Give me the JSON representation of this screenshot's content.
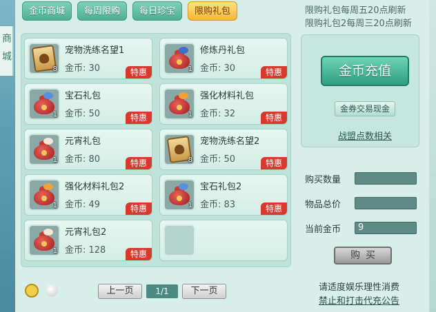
{
  "left_sidebar": {
    "label": "商城"
  },
  "tabs": [
    {
      "label": "金币商城",
      "active": false
    },
    {
      "label": "每周限购",
      "active": false
    },
    {
      "label": "每日珍宝",
      "active": false
    },
    {
      "label": "限购礼包",
      "active": true
    }
  ],
  "refresh_note": [
    "限购礼包每周五20点刷新",
    "限购礼包2每周三20点刷新"
  ],
  "items": [
    {
      "name": "宠物洗练名望1",
      "price": "金币: 30",
      "count": "8",
      "badge": "特惠",
      "icon": "scroll-icon"
    },
    {
      "name": "修炼丹礼包",
      "price": "金币: 30",
      "count": "1",
      "badge": "特惠",
      "icon": "gift-bag-icon"
    },
    {
      "name": "宝石礼包",
      "price": "金币: 50",
      "count": "1",
      "badge": "特惠",
      "icon": "gift-bag-icon"
    },
    {
      "name": "强化材料礼包",
      "price": "金币: 32",
      "count": "1",
      "badge": "特惠",
      "icon": "gift-bag-icon"
    },
    {
      "name": "元宵礼包",
      "price": "金币: 80",
      "count": "1",
      "badge": "特惠",
      "icon": "gift-bag-icon"
    },
    {
      "name": "宠物洗练名望2",
      "price": "金币: 50",
      "count": "8",
      "badge": "特惠",
      "icon": "scroll-icon"
    },
    {
      "name": "强化材料礼包2",
      "price": "金币: 49",
      "count": "1",
      "badge": "特惠",
      "icon": "gift-bag-icon"
    },
    {
      "name": "宝石礼包2",
      "price": "金币: 83",
      "count": "1",
      "badge": "特惠",
      "icon": "gift-bag-icon"
    },
    {
      "name": "元宵礼包2",
      "price": "金币: 128",
      "count": "1",
      "badge": "特惠",
      "icon": "gift-bag-icon"
    }
  ],
  "pager": {
    "prev_label": "上一页",
    "page": "1/1",
    "next_label": "下一页"
  },
  "right_panel": {
    "recharge_label": "金币充值",
    "exchange_label": "金券交易现金",
    "alliance_label": "战盟点数相关"
  },
  "fields": {
    "quantity_label": "购买数量",
    "quantity_value": "",
    "total_label": "物品总价",
    "total_value": "",
    "gold_label": "当前金币",
    "gold_value": "9"
  },
  "buy_label": "购买",
  "footer": {
    "notice": "请适度娱乐理性消费",
    "anti_fraud": "禁止和打击代充公告"
  },
  "colors": {
    "badge_red": "#d63a2e",
    "tab_active": "#f2b73a",
    "tab_normal": "#4fae93"
  }
}
